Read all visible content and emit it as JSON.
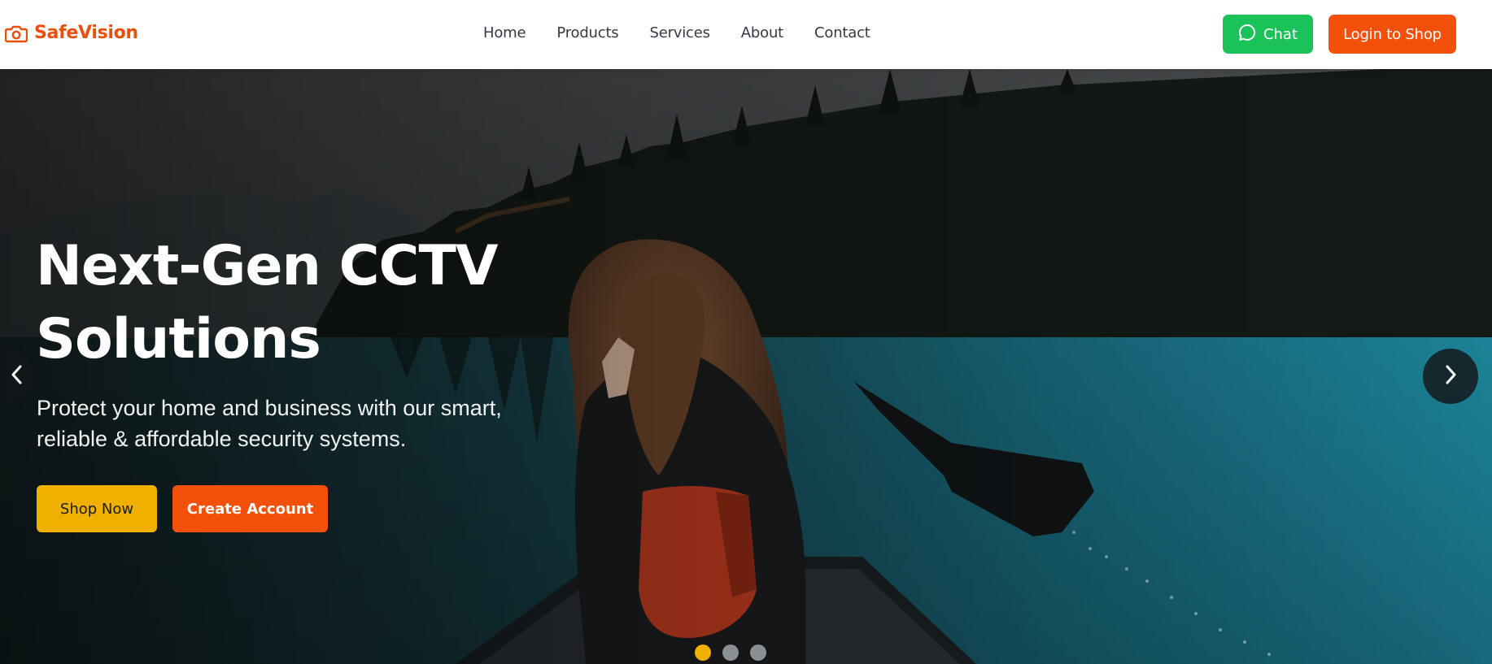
{
  "brand": {
    "name": "SafeVision",
    "icon": "camera-icon",
    "color": "#ea4f0c"
  },
  "nav": {
    "items": [
      {
        "label": "Home"
      },
      {
        "label": "Products"
      },
      {
        "label": "Services"
      },
      {
        "label": "About"
      },
      {
        "label": "Contact"
      }
    ]
  },
  "header_actions": {
    "chat_label": "Chat",
    "chat_icon": "chat-bubble-icon",
    "chat_color": "#1bc25a",
    "login_label": "Login to Shop",
    "login_color": "#f2500b"
  },
  "hero": {
    "title_line1": "Next-Gen CCTV",
    "title_line2": "Solutions",
    "subtitle_line1": "Protect your home and business with our smart,",
    "subtitle_line2": "reliable & affordable security systems.",
    "primary_cta": "Shop Now",
    "primary_color": "#f0b000",
    "secondary_cta": "Create Account",
    "secondary_color": "#f2500b",
    "prev_icon": "chevron-left-icon",
    "next_icon": "chevron-right-icon",
    "slides_total": 3,
    "active_slide": 1
  }
}
